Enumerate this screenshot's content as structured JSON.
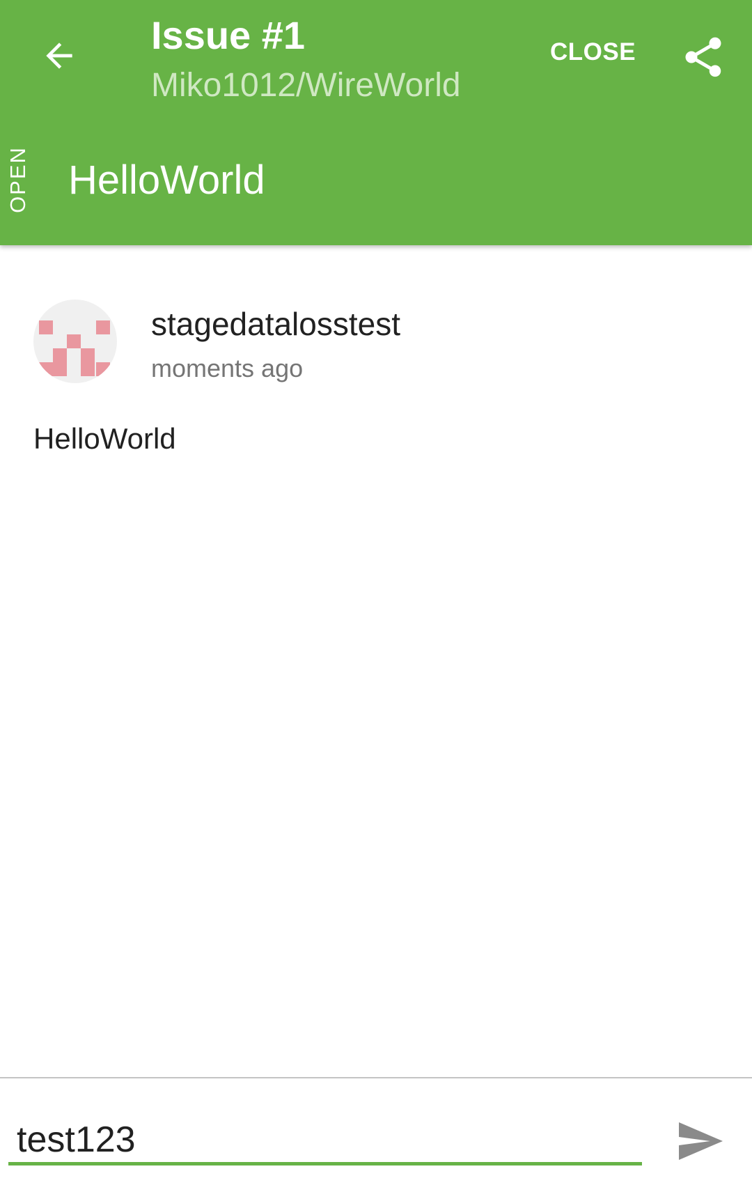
{
  "header": {
    "title": "Issue #1",
    "subtitle": "Miko1012/WireWorld",
    "close_label": "CLOSE",
    "back_icon": "arrow-back-icon",
    "share_icon": "share-icon",
    "state": "OPEN",
    "issue_title": "HelloWorld",
    "background_color": "#67b346"
  },
  "comment": {
    "author": "stagedatalosstest",
    "time": "moments ago",
    "body": "HelloWorld",
    "avatar_color": "#e9979f"
  },
  "input": {
    "value": "test123",
    "send_icon": "send-icon",
    "accent_color": "#67b346"
  }
}
